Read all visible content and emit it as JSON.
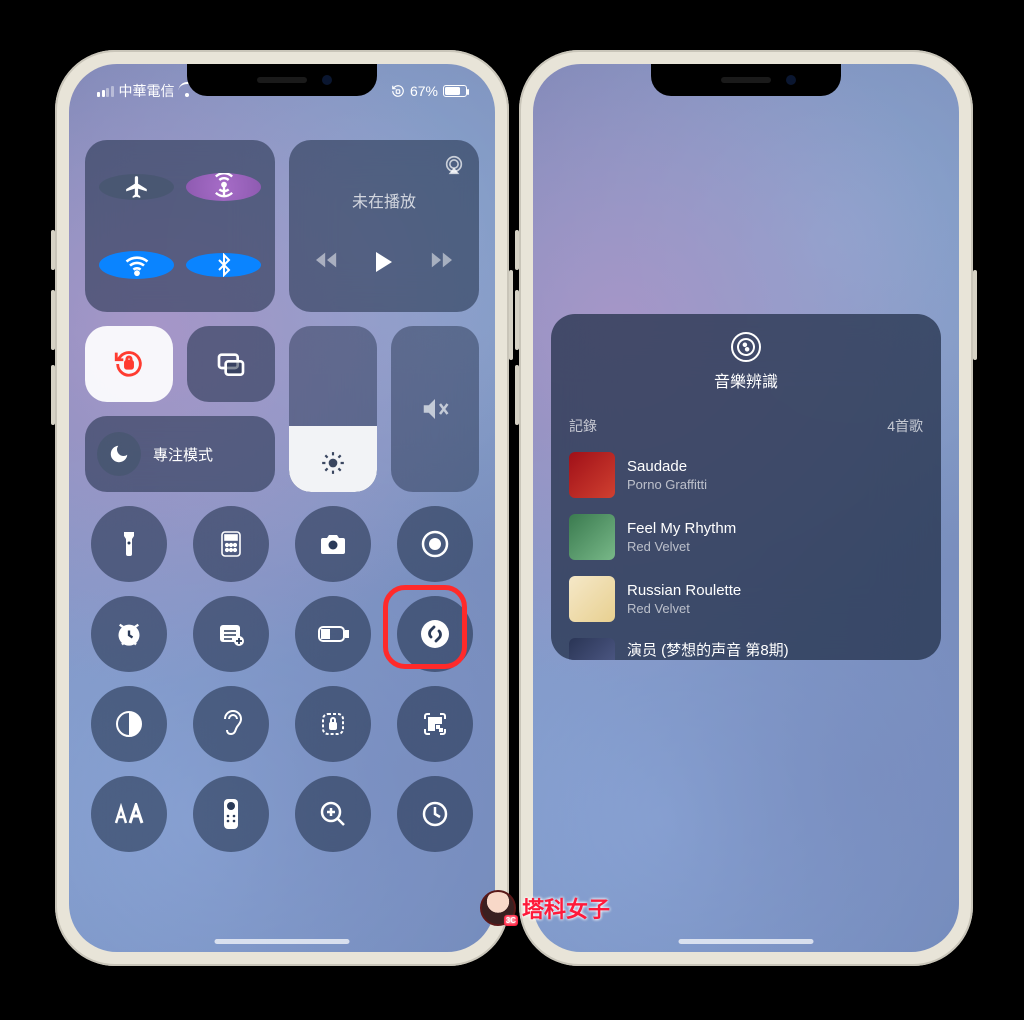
{
  "status": {
    "carrier": "中華電信",
    "battery_text": "67%"
  },
  "media": {
    "title": "未在播放"
  },
  "focus": {
    "label": "專注模式"
  },
  "shazam_panel": {
    "title": "音樂辨識",
    "history_label": "記錄",
    "count_label": "4首歌",
    "songs": [
      {
        "title": "Saudade",
        "artist": "Porno Graffitti"
      },
      {
        "title": "Feel My Rhythm",
        "artist": "Red Velvet"
      },
      {
        "title": "Russian Roulette",
        "artist": "Red Velvet"
      },
      {
        "title": "演员 (梦想的声音 第8期)",
        "artist": ""
      }
    ]
  },
  "watermark": "塔科女子",
  "icons": {
    "flashlight": "flashlight-icon",
    "calculator": "calculator-icon",
    "camera": "camera-icon",
    "record": "screen-record-icon",
    "alarm": "alarm-icon",
    "notes": "quick-note-icon",
    "low_power": "low-power-icon",
    "shazam": "shazam-icon",
    "dark_mode": "dark-mode-icon",
    "hearing": "hearing-icon",
    "lock_rotation_access": "guided-access-icon",
    "qr": "qr-scan-icon",
    "text_size": "text-size-icon",
    "remote": "apple-tv-remote-icon",
    "magnifier": "magnifier-icon",
    "timer": "timer-icon"
  }
}
